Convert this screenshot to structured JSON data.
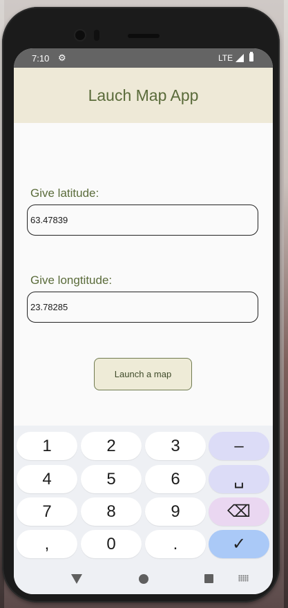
{
  "status": {
    "time": "7:10",
    "network": "LTE",
    "settings_icon": "gear-icon"
  },
  "app": {
    "title": "Lauch Map App"
  },
  "latitude": {
    "label": "Give latitude:",
    "value": "63.47839"
  },
  "longitude": {
    "label": "Give longtitude:",
    "value": "23.78285"
  },
  "action": {
    "launch_label": "Launch a map"
  },
  "keyboard": {
    "rows": [
      [
        "1",
        "2",
        "3",
        "–"
      ],
      [
        "4",
        "5",
        "6",
        "␣"
      ],
      [
        "7",
        "8",
        "9",
        "⌫"
      ],
      [
        ",",
        "0",
        ".",
        "✓"
      ]
    ]
  },
  "colors": {
    "appbar": "#eee9d7",
    "title": "#5a6b3a",
    "enter_key": "#aac9f7",
    "function_key": "#dcdcf7",
    "delete_key": "#ead7f1"
  }
}
